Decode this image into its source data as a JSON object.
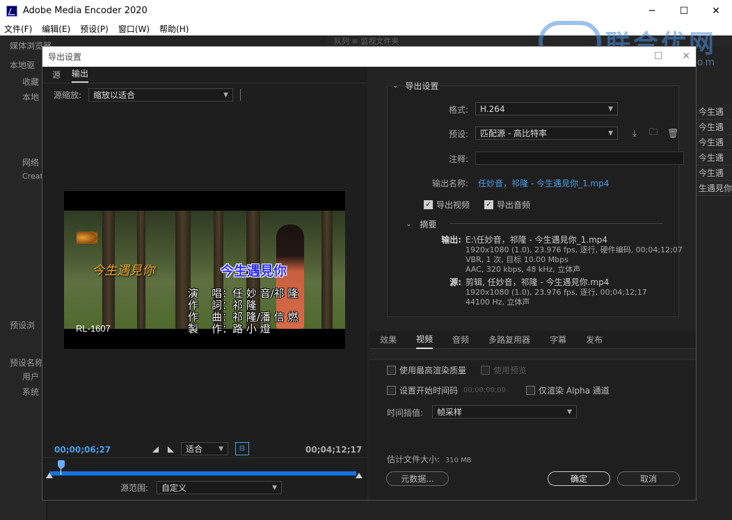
{
  "app": {
    "title": "Adobe Media Encoder 2020",
    "minimize": "─",
    "maximize": "☐",
    "close": "✕"
  },
  "menu": [
    "文件(F)",
    "编辑(E)",
    "预设(P)",
    "窗口(W)",
    "帮助(H)"
  ],
  "background": {
    "left_labels": [
      "媒体浏览器",
      "本地驱",
      "收藏",
      "本地",
      "网络",
      "Creat",
      "预设浏",
      "预设名称",
      "用户",
      "系统"
    ],
    "top_strip": "队列   ≡     监视文件夹",
    "right_rows": [
      "今生遇",
      "今生遇",
      "今生遇",
      "今生遇",
      "今生遇",
      "生遇見你"
    ]
  },
  "watermark": {
    "text": "联合优网",
    "sub": "www.unyoo.com"
  },
  "dialog": {
    "title": "导出设置",
    "source_tabs": [
      "源",
      "输出"
    ],
    "source_scale_label": "源缩放:",
    "source_scale_value": "缩放以适合",
    "video": {
      "song_title": "今生遇見你",
      "song_title_left": "今生遇見你",
      "credits": "演    唱：任 妙 音/祁 隆\n作    詞：祁 隆\n作    曲：祁 隆/潘 信 燃\n製    作：路 小 燈",
      "code": "RL-1607"
    },
    "timeline": {
      "start_tc": "00;00;06;27",
      "end_tc": "00;04;12;17",
      "fit_value": "适合",
      "range_label": "源范围:",
      "range_value": "自定义"
    },
    "export": {
      "section_title": "导出设置",
      "format_label": "格式:",
      "format_value": "H.264",
      "preset_label": "预设:",
      "preset_value": "匹配源 - 高比特率",
      "comment_label": "注释:",
      "comment_value": "",
      "output_name_label": "输出名称:",
      "output_name_value": "任妙音，祁隆 - 今生遇見你_1.mp4",
      "export_video_label": "导出视频",
      "export_audio_label": "导出音频",
      "summary_label": "摘要",
      "output_label": "输出:",
      "output_lines": [
        "E:\\任妙音，祁隆 - 今生遇見你_1.mp4",
        "1920x1080 (1.0), 23.976 fps, 逐行, 硬件编码, 00;04;12;07",
        "VBR, 1 次, 目标 10.00 Mbps",
        "AAC, 320 kbps, 48 kHz, 立体声"
      ],
      "source_label": "源:",
      "source_lines": [
        "剪辑, 任妙音，祁隆 - 今生遇見你.mp4",
        "1920x1080 (1.0), 23.976 fps, 逐行, 00;04;12;17",
        "44100 Hz, 立体声"
      ]
    },
    "bottom_tabs": [
      "效果",
      "视频",
      "音频",
      "多路复用器",
      "字幕",
      "发布"
    ],
    "options": {
      "max_render_quality": "使用最高渲染质量",
      "use_previews": "使用预览",
      "set_start_tc": "设置开始时间码",
      "start_tc_value": "00;00;00;00",
      "render_alpha_only": "仅渲染 Alpha 通道",
      "time_interp_label": "时间插值:",
      "time_interp_value": "帧采样",
      "est_file_size": "估计文件大小:",
      "est_file_size_value": "310 MB"
    },
    "buttons": {
      "metadata": "元数据...",
      "ok": "确定",
      "cancel": "取消"
    }
  }
}
